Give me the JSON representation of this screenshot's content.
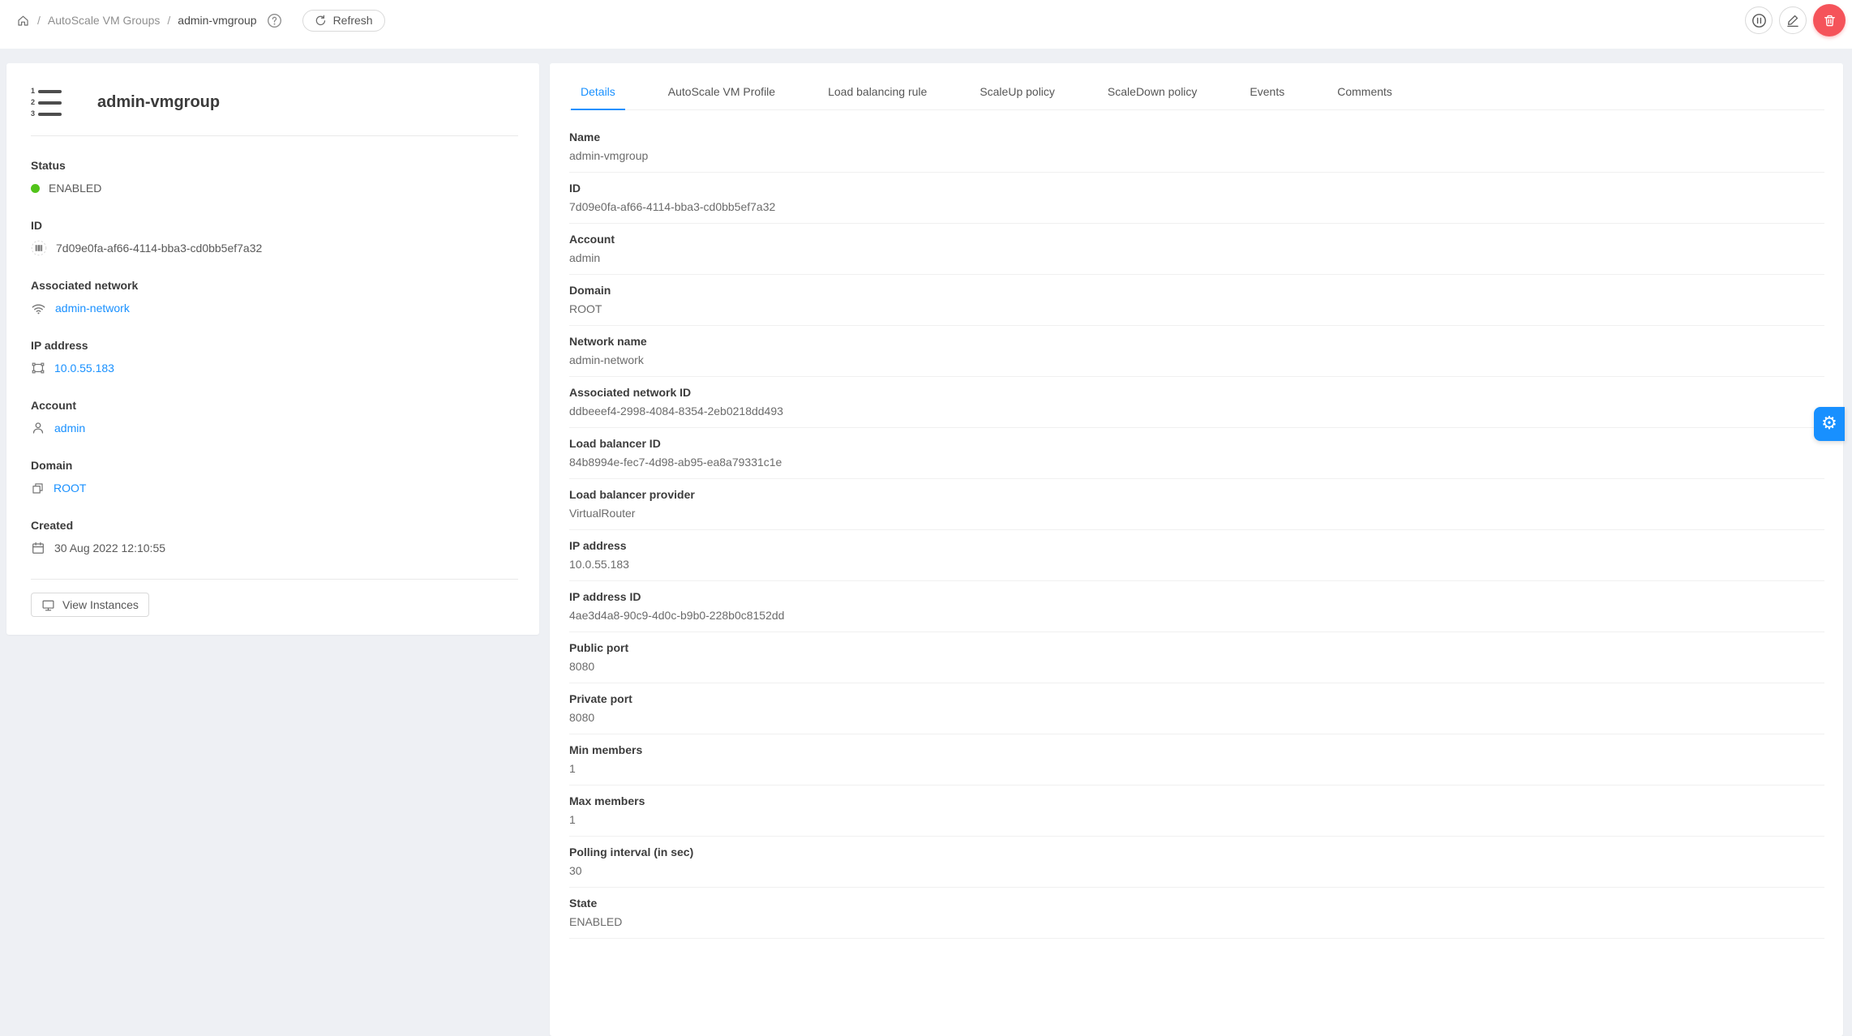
{
  "breadcrumb": {
    "separator": "/",
    "items": [
      {
        "label": "AutoScale VM Groups",
        "current": false
      },
      {
        "label": "admin-vmgroup",
        "current": true
      }
    ],
    "refresh_label": "Refresh"
  },
  "header_actions": [
    {
      "id": "pause",
      "icon": "pause-circle-icon"
    },
    {
      "id": "edit",
      "icon": "edit-icon"
    },
    {
      "id": "delete",
      "icon": "delete-icon"
    }
  ],
  "resource": {
    "title": "admin-vmgroup",
    "sections": [
      {
        "label": "Status",
        "value": "ENABLED",
        "icon": "status-dot",
        "style": "status"
      },
      {
        "label": "ID",
        "value": "7d09e0fa-af66-4114-bba3-cd0bb5ef7a32",
        "icon": "barcode-icon",
        "style": "plain"
      },
      {
        "label": "Associated network",
        "value": "admin-network",
        "icon": "wifi-icon",
        "style": "link"
      },
      {
        "label": "IP address",
        "value": "10.0.55.183",
        "icon": "environment-icon",
        "style": "link"
      },
      {
        "label": "Account",
        "value": "admin",
        "icon": "user-icon",
        "style": "link"
      },
      {
        "label": "Domain",
        "value": "ROOT",
        "icon": "block-icon",
        "style": "link"
      },
      {
        "label": "Created",
        "value": "30 Aug 2022 12:10:55",
        "icon": "calendar-icon",
        "style": "plain"
      }
    ],
    "view_instances_label": "View Instances"
  },
  "tabs": {
    "active": "Details",
    "items": [
      "Details",
      "AutoScale VM Profile",
      "Load balancing rule",
      "ScaleUp policy",
      "ScaleDown policy",
      "Events",
      "Comments"
    ]
  },
  "details": [
    {
      "label": "Name",
      "value": "admin-vmgroup"
    },
    {
      "label": "ID",
      "value": "7d09e0fa-af66-4114-bba3-cd0bb5ef7a32"
    },
    {
      "label": "Account",
      "value": "admin"
    },
    {
      "label": "Domain",
      "value": "ROOT"
    },
    {
      "label": "Network name",
      "value": "admin-network"
    },
    {
      "label": "Associated network ID",
      "value": "ddbeeef4-2998-4084-8354-2eb0218dd493"
    },
    {
      "label": "Load balancer ID",
      "value": "84b8994e-fec7-4d98-ab95-ea8a79331c1e"
    },
    {
      "label": "Load balancer provider",
      "value": "VirtualRouter"
    },
    {
      "label": "IP address",
      "value": "10.0.55.183"
    },
    {
      "label": "IP address ID",
      "value": "4ae3d4a8-90c9-4d0c-b9b0-228b0c8152dd"
    },
    {
      "label": "Public port",
      "value": "8080"
    },
    {
      "label": "Private port",
      "value": "8080"
    },
    {
      "label": "Min members",
      "value": "1"
    },
    {
      "label": "Max members",
      "value": "1"
    },
    {
      "label": "Polling interval (in sec)",
      "value": "30"
    },
    {
      "label": "State",
      "value": "ENABLED"
    }
  ],
  "colors": {
    "accent": "#1890ff",
    "status_enabled": "#52c41a",
    "danger": "#f5535a",
    "background": "#eef0f4"
  }
}
